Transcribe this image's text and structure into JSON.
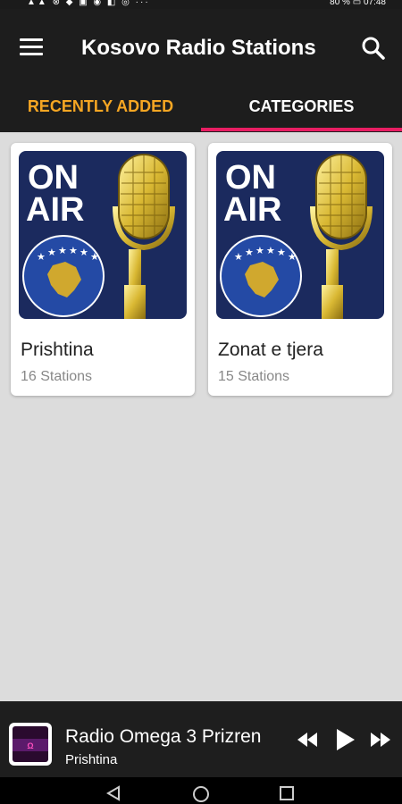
{
  "status_bar": {
    "left_icons": "▲▲ ⊗ ◆ ▣ ◉ ◧ ◎ ···",
    "battery": "80 %",
    "time": "07:48"
  },
  "app": {
    "title": "Kosovo Radio Stations",
    "menu_icon": "hamburger-menu-icon",
    "search_icon": "search-icon"
  },
  "tabs": [
    {
      "label": "RECENTLY ADDED",
      "active": false
    },
    {
      "label": "CATEGORIES",
      "active": true
    }
  ],
  "categories": [
    {
      "name": "Prishtina",
      "count": "16 Stations",
      "image_text": [
        "ON",
        "AIR"
      ]
    },
    {
      "name": "Zonat e tjera",
      "count": "15 Stations",
      "image_text": [
        "ON",
        "AIR"
      ]
    }
  ],
  "player": {
    "station": "Radio Omega 3 Prizren",
    "category": "Prishtina",
    "controls": [
      "rewind-icon",
      "play-icon",
      "fast-forward-icon"
    ]
  },
  "colors": {
    "accent_active_tab": "#f5a623",
    "indicator": "#e91e63",
    "toolbar": "#1d1d1d",
    "card_bg": "#1b2a5e",
    "mic_gold": "#d9b833"
  }
}
